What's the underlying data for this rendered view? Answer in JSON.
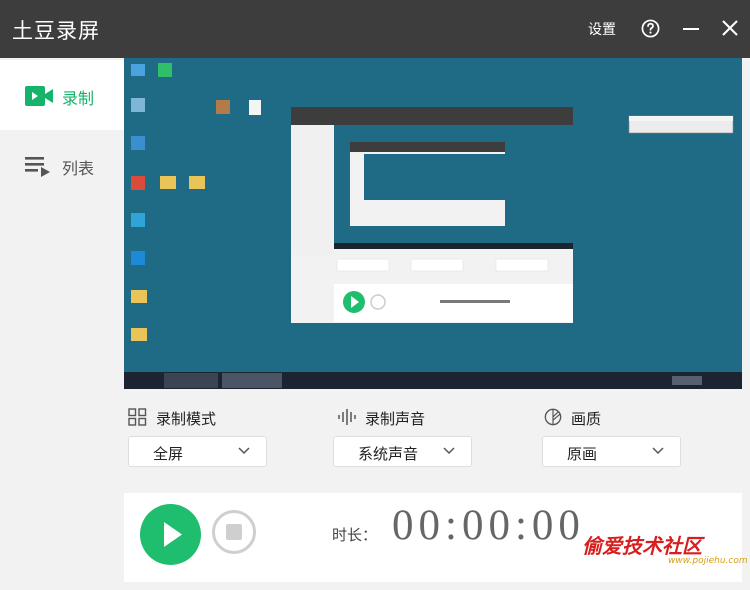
{
  "app": {
    "title": "土豆录屏"
  },
  "titlebar": {
    "settings_label": "设置",
    "icons": [
      "help-icon",
      "minimize-icon",
      "close-icon"
    ]
  },
  "sidebar": {
    "items": [
      {
        "label": "录制",
        "icon": "video-camera-icon",
        "active": true
      },
      {
        "label": "列表",
        "icon": "list-icon",
        "active": false
      }
    ]
  },
  "settings": {
    "mode": {
      "title": "录制模式",
      "value": "全屏",
      "icon": "grid-icon"
    },
    "audio": {
      "title": "录制声音",
      "value": "系统声音",
      "icon": "soundwave-icon"
    },
    "quality": {
      "title": "画质",
      "value": "原画",
      "icon": "quality-icon"
    }
  },
  "controls": {
    "duration_label": "时长：",
    "duration_value": "00:00:00"
  },
  "watermark": {
    "title": "偷爱技术社区",
    "url": "www.pojiehu.com"
  },
  "colors": {
    "accent": "#1fbd6e",
    "titlebar": "#3d3d3d",
    "desktop": "#1e6f8c"
  }
}
